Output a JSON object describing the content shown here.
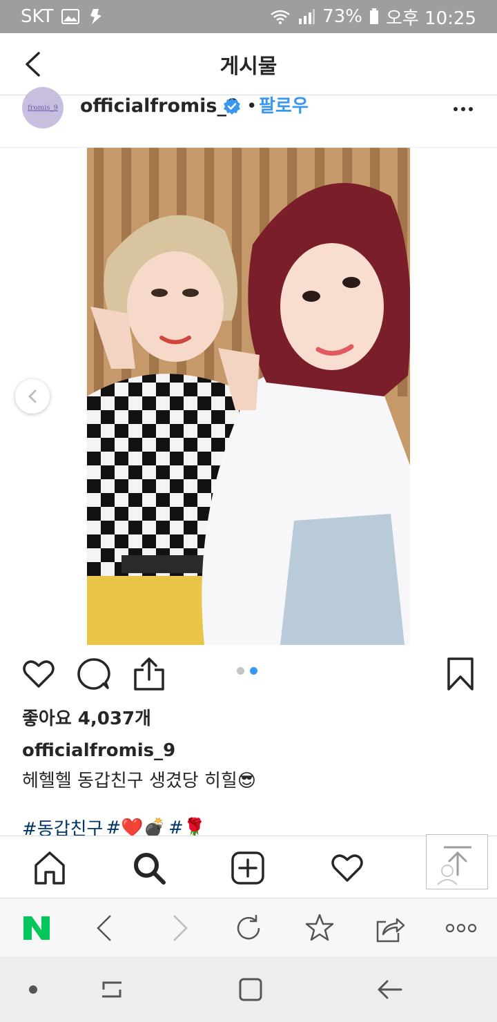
{
  "status_bar": {
    "carrier": "SKT",
    "battery": "73%",
    "time": "오후 10:25"
  },
  "header": {
    "title": "게시물"
  },
  "post": {
    "avatar_text": "fromis_9",
    "username": "officialfromis_9",
    "separator": "•",
    "follow_label": "팔로우",
    "carousel": {
      "total": 2,
      "active_index": 1
    },
    "likes": "좋아요 4,037개",
    "caption_user": "officialfromis_9",
    "caption_text": "헤헬헬 동갑친구 생겼당 히힐😎",
    "hashtags": [
      "#동갑친구",
      "#❤️💣",
      "#🌹"
    ]
  },
  "colors": {
    "accent": "#3897f0",
    "hashtag": "#003569",
    "naver_green": "#03c75a"
  }
}
